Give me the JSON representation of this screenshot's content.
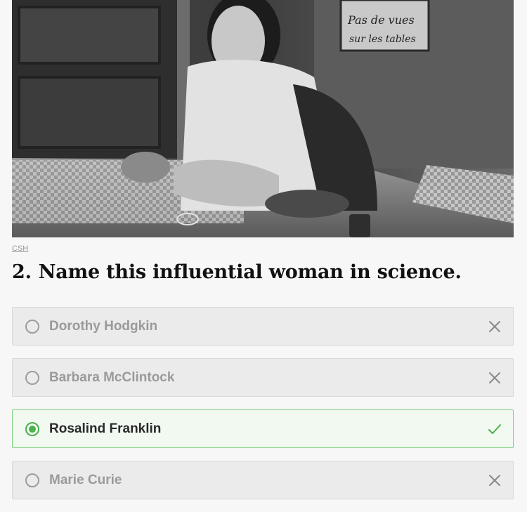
{
  "photo": {
    "credit": "CSH",
    "sign_lines": [
      "Pas de vues",
      "sur les tables"
    ]
  },
  "question": {
    "number": "2.",
    "text": "Name this influential woman in science."
  },
  "answers": [
    {
      "label": "Dorothy Hodgkin",
      "status": "incorrect",
      "icon": "close-icon"
    },
    {
      "label": "Barbara McClintock",
      "status": "incorrect",
      "icon": "close-icon"
    },
    {
      "label": "Rosalind Franklin",
      "status": "correct",
      "icon": "check-icon"
    },
    {
      "label": "Marie Curie",
      "status": "incorrect",
      "icon": "close-icon"
    }
  ],
  "colors": {
    "correct": "#4cb04c",
    "incorrect_mark": "#8a8a8a"
  }
}
